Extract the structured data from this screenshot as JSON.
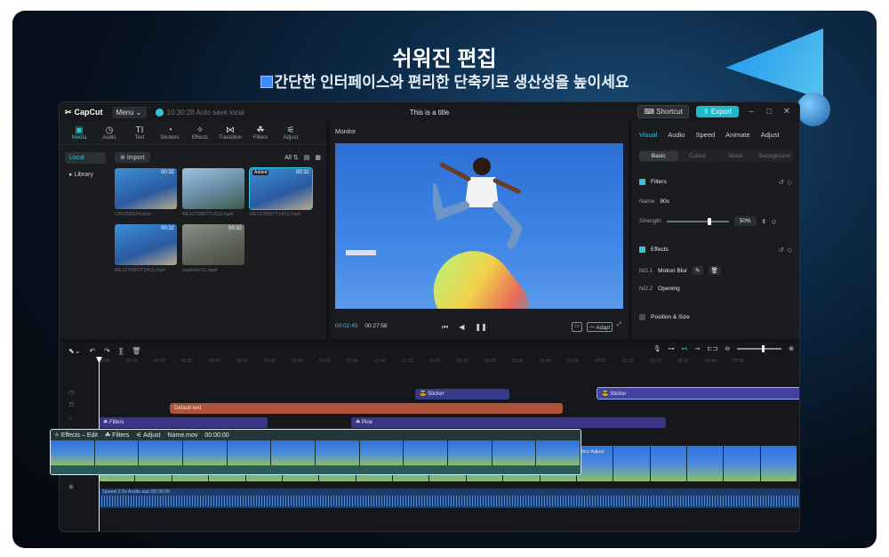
{
  "hero": {
    "title": "쉬워진 편집",
    "subtitle": "간단한 인터페이스와 편리한 단축키로 생산성을 높이세요"
  },
  "titlebar": {
    "app": "CapCut",
    "menu": "Menu",
    "save_status": "10:30:28 Auto save local",
    "title": "This is a title",
    "shortcut": "Shortcut",
    "export": "Export"
  },
  "media": {
    "tabs": [
      "Media",
      "Audio",
      "Text",
      "Stickers",
      "Effects",
      "Transition",
      "Filters",
      "Adjust"
    ],
    "side": [
      "Local",
      "Library"
    ],
    "import": "Import",
    "all": "All",
    "items": [
      {
        "name": "CR0700334.mov",
        "dur": "00:32",
        "badge": ""
      },
      {
        "name": "RE1278367T1412.mp4",
        "dur": "",
        "badge": ""
      },
      {
        "name": "RE1278367T1412.mp4",
        "dur": "00:32",
        "badge": "Added"
      },
      {
        "name": "RE1278367T1412.mp4",
        "dur": "00:32",
        "badge": ""
      },
      {
        "name": "material 01.mp4",
        "dur": "00:32",
        "badge": ""
      }
    ]
  },
  "monitor": {
    "label": "Monitor",
    "current": "00:02:45",
    "total": "00:27:58",
    "adapt": "Adapt"
  },
  "inspector": {
    "tabs": [
      "Visual",
      "Audio",
      "Speed",
      "Animate",
      "Adjust"
    ],
    "subtabs": [
      "Basic",
      "Cutout",
      "Mask",
      "Background"
    ],
    "filters": "Filters",
    "name_label": "Name",
    "name_value": "90s",
    "strength_label": "Strength",
    "strength_value": "50%",
    "effects": "Effects",
    "no1": "NO.1",
    "no1_value": "Motion Blur",
    "no2": "NO.2",
    "no2_value": "Opening",
    "position": "Position & Size"
  },
  "timeline": {
    "ruler": [
      "00:00",
      "00:10",
      "00:20",
      "00:30",
      "00:40",
      "00:50",
      "01:00",
      "01:10",
      "01:20",
      "01:30",
      "01:40",
      "01:50",
      "02:00",
      "02:10",
      "02:20",
      "02:30",
      "02:40",
      "02:50",
      "03:00",
      "03:10",
      "03:20",
      "03:30",
      "03:40",
      "03:50"
    ],
    "sticker1": "Sticker",
    "sticker2": "Sticker",
    "default_text": "Default text",
    "filters": "Filters",
    "pine": "Pine",
    "audio_label": "Speed 2.0x  Audio.aac  00:00:00",
    "right_clip": "Filters  Adjust"
  },
  "edit_popup": {
    "effects": "Effects – Edit",
    "filters": "Filters",
    "adjust": "Adjust",
    "name": "Name.mov",
    "time": "00:00:00"
  }
}
